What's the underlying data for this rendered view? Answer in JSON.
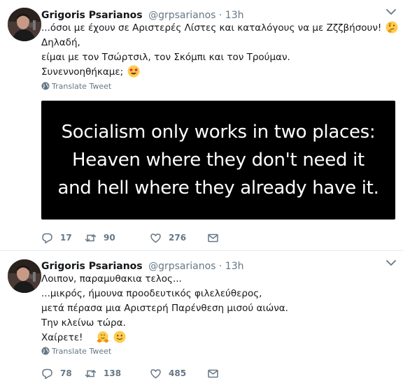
{
  "tweets": [
    {
      "author_name": "Grigoris Psarianos",
      "author_handle": "@grpsarianos",
      "separator": "·",
      "time": "13h",
      "lines": [
        "...όσοι με έχουν σε Αριστερές Λίστες και καταλόγους να με Ζζζβήσουν!",
        "Δηλαδή,",
        "είμαι με τον Τσώρτσιλ, τον Σκόμπι και τον Τρούμαν.",
        "Συνεννοηθήκαμε;"
      ],
      "translate_label": "Translate Tweet",
      "media_lines": [
        "Socialism only works in two places:",
        "Heaven where they don't need it",
        "and hell where they already have it."
      ],
      "replies": "17",
      "retweets": "90",
      "likes": "276"
    },
    {
      "author_name": "Grigoris Psarianos",
      "author_handle": "@grpsarianos",
      "separator": "·",
      "time": "13h",
      "lines": [
        "Λοιπον, παραμυθακια τελος...",
        "...μικρός, ήμουνα προοδευτικός φιλελεύθερος,",
        "μετά πέρασα μια Αριστερή Παρένθεση μισού αιώνα.",
        "Την κλείνω τώρα.",
        "Χαίρετε!"
      ],
      "translate_label": "Translate Tweet",
      "replies": "78",
      "retweets": "138",
      "likes": "485"
    }
  ],
  "icons": {
    "reply": "reply-icon",
    "retweet": "retweet-icon",
    "like": "heart-icon",
    "dm": "direct-message-icon",
    "caret": "chevron-down-icon",
    "globe": "globe-icon",
    "emoji_1": "thinking-face-emoji",
    "emoji_2": "star-struck-emoji",
    "emoji_3": "hugging-face-emoji",
    "emoji_4": "slightly-smiling-face-emoji"
  },
  "colors": {
    "text": "#14171a",
    "secondary": "#657786",
    "divider": "#e6ecf0",
    "media_bg": "#000000",
    "emoji_yellow": "#ffcc4d"
  }
}
